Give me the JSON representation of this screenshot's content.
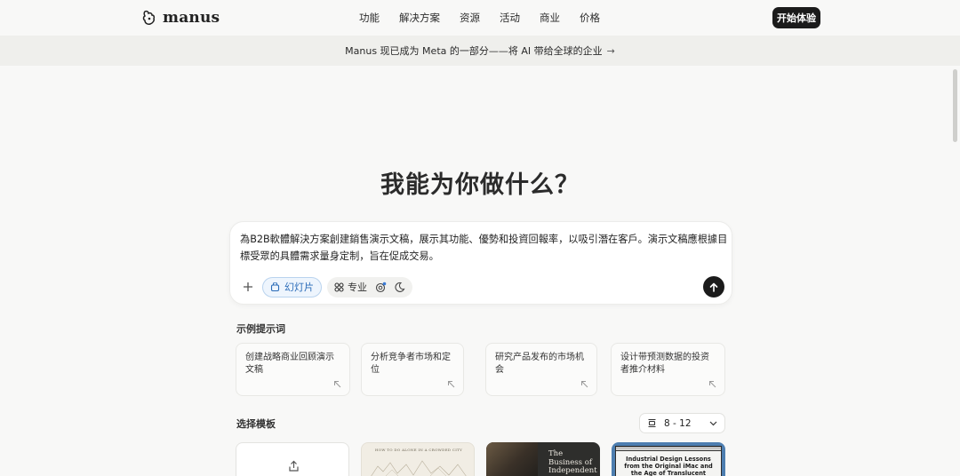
{
  "header": {
    "logo_text": "manus",
    "nav": [
      "功能",
      "解决方案",
      "资源",
      "活动",
      "商业",
      "价格"
    ],
    "cta_label": "开始体验"
  },
  "banner": {
    "text": "Manus 现已成为 Meta 的一部分——将 AI 带给全球的企业",
    "arrow": "→"
  },
  "main": {
    "title": "我能为你做什么？"
  },
  "composer": {
    "value": "為B2B軟體解決方案創建銷售演示文稿，展示其功能、優勢和投資回報率，以吸引潛在客戶。演示文稿應根據目標受眾的具體需求量身定制，旨在促成交易。",
    "add_icon": "plus-icon",
    "slides_chip": "幻灯片",
    "pro_chip": "专业",
    "send_icon": "arrow-up-icon",
    "accent_color": "#2a6bb8"
  },
  "examples": {
    "label": "示例提示词",
    "items": [
      "创建战略商业回顾演示文稿",
      "分析竞争者市场和定位",
      "研究产品发布的市场机会",
      "设计带预测数据的投资者推介材料"
    ]
  },
  "templates": {
    "label": "选择模板",
    "size_select": "8 - 12",
    "cards": [
      {
        "type": "upload",
        "text": ""
      },
      {
        "type": "sketch",
        "text": "HOW TO DO ALONE IN A CROWDED CITY"
      },
      {
        "type": "dark",
        "text": "The Business of Independent"
      },
      {
        "type": "mac",
        "text": "Industrial Design Lessons from the Original iMac and the Age of Translucent Plastics"
      }
    ]
  }
}
